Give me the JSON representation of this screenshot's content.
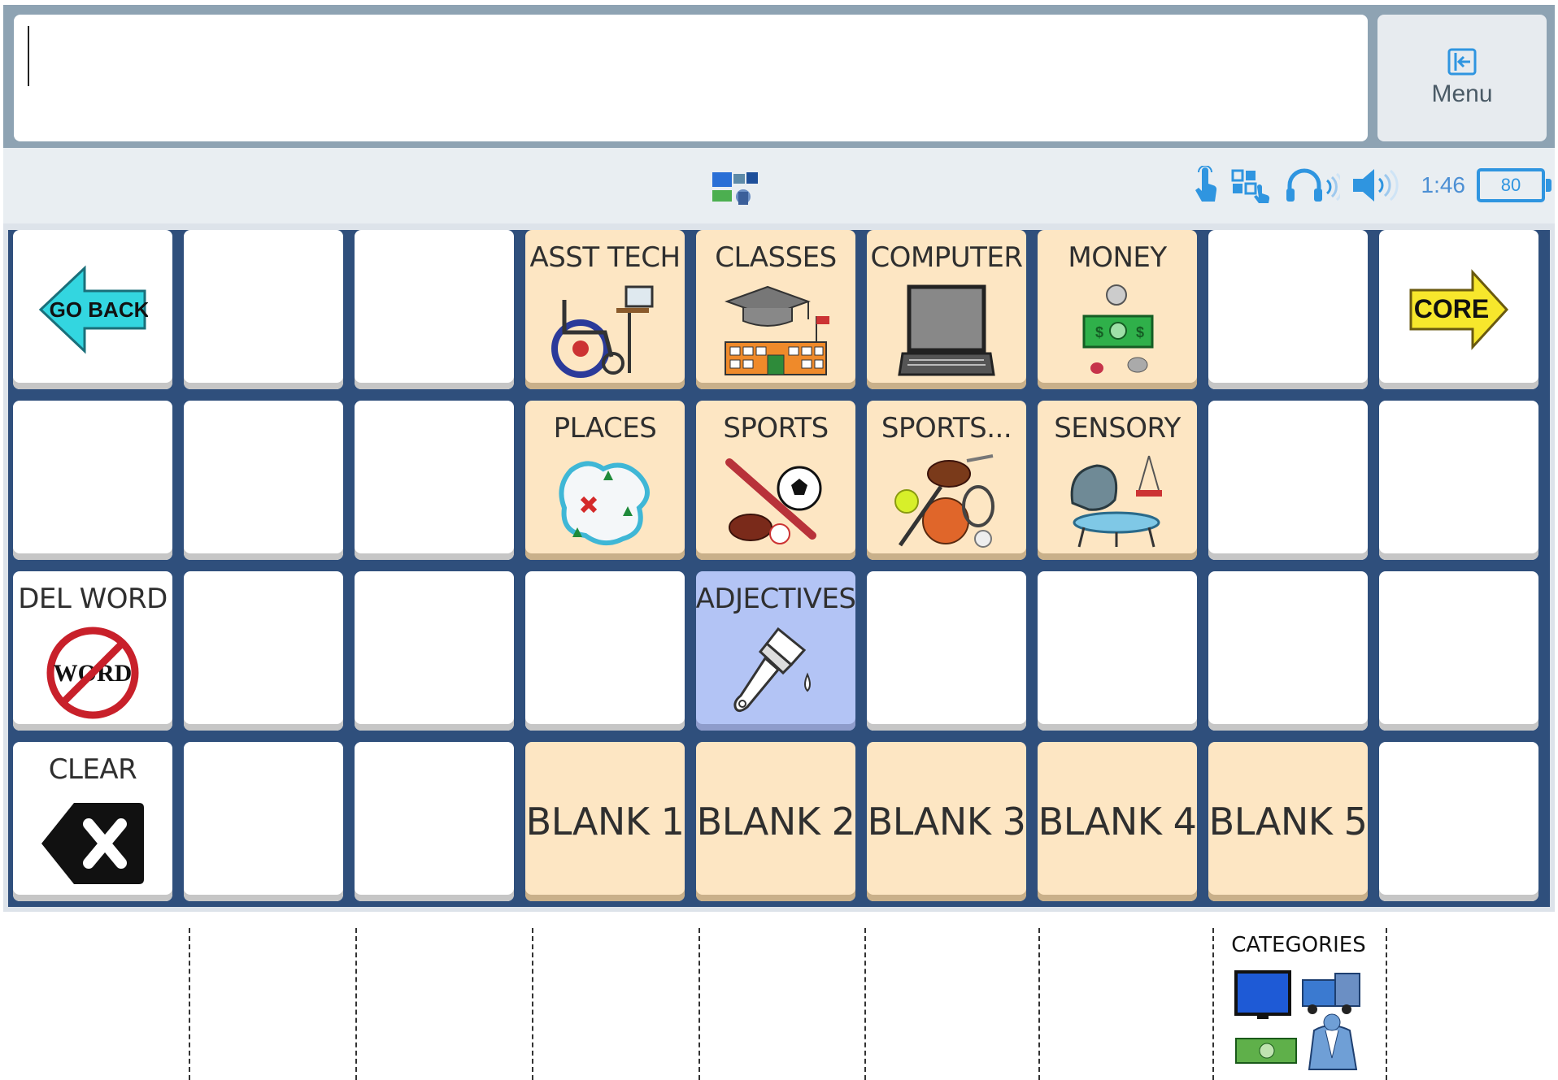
{
  "message_bar": {
    "text": ""
  },
  "menu": {
    "label": "Menu"
  },
  "status": {
    "time": "1:46",
    "battery": "80"
  },
  "grid": {
    "row1": {
      "go_back": "GO BACK",
      "asst_tech": "ASST TECH",
      "classes": "CLASSES",
      "computer": "COMPUTER",
      "money": "MONEY",
      "core": "CORE"
    },
    "row2": {
      "places": "PLACES",
      "sports": "SPORTS",
      "sports_more": "SPORTS...",
      "sensory": "SENSORY"
    },
    "row3": {
      "del_word": "DEL WORD",
      "del_word_icon_text": "WORD",
      "adjectives": "ADJECTIVES"
    },
    "row4": {
      "clear": "CLEAR",
      "blank1": "BLANK 1",
      "blank2": "BLANK 2",
      "blank3": "BLANK 3",
      "blank4": "BLANK 4",
      "blank5": "BLANK 5"
    }
  },
  "footer": {
    "categories_label": "CATEGORIES"
  },
  "colors": {
    "category_cell": "#fde6c3",
    "adjective_cell": "#b3c4f5",
    "grid_background": "#2f4f7c",
    "accent_blue": "#2f95e0"
  }
}
